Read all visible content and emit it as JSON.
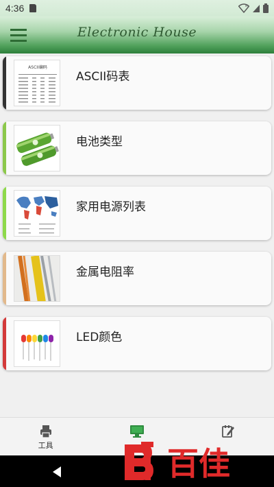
{
  "status_bar": {
    "time": "4:36"
  },
  "app_bar": {
    "title": "Electronic House"
  },
  "items": [
    {
      "label": "ASCII码表",
      "accent": "#333333",
      "thumb_caption": "ASCII编码"
    },
    {
      "label": "电池类型",
      "accent": "#8cc84b",
      "thumb_caption": ""
    },
    {
      "label": "家用电源列表",
      "accent": "#8ed94a",
      "thumb_caption": ""
    },
    {
      "label": "金属电阻率",
      "accent": "#e2b98c",
      "thumb_caption": ""
    },
    {
      "label": "LED颜色",
      "accent": "#d33a3a",
      "thumb_caption": ""
    }
  ],
  "bottom_nav": [
    {
      "label": "工具",
      "icon": "printer-icon"
    },
    {
      "label": "",
      "icon": "monitor-icon"
    },
    {
      "label": "",
      "icon": "edit-note-icon"
    }
  ],
  "watermark": {
    "text": "百佳"
  }
}
